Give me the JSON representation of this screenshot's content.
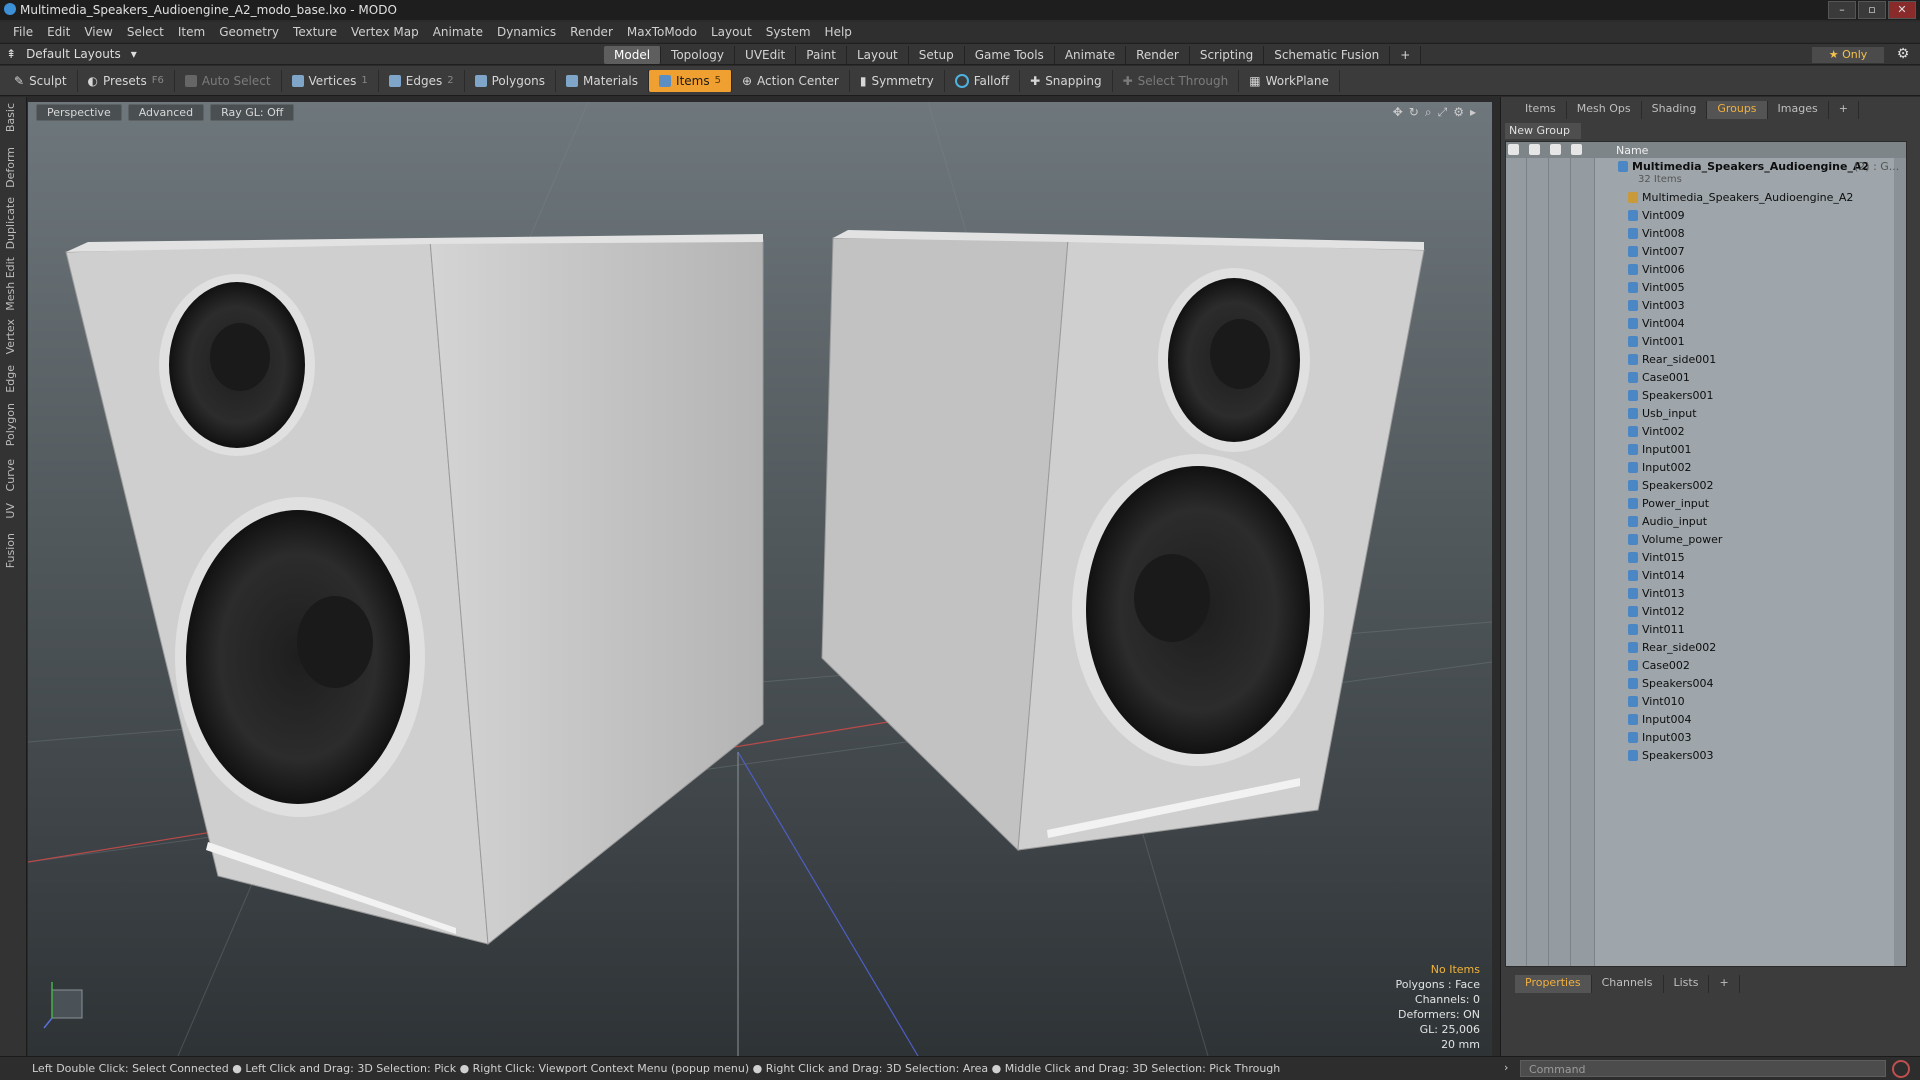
{
  "window": {
    "title": "Multimedia_Speakers_Audioengine_A2_modo_base.lxo - MODO",
    "controls": [
      "–",
      "▫",
      "✕"
    ]
  },
  "menu": [
    "File",
    "Edit",
    "View",
    "Select",
    "Item",
    "Geometry",
    "Texture",
    "Vertex Map",
    "Animate",
    "Dynamics",
    "Render",
    "MaxToModo",
    "Layout",
    "System",
    "Help"
  ],
  "layoutbar": {
    "layout": "Default Layouts",
    "tabs": [
      "Model",
      "Topology",
      "UVEdit",
      "Paint",
      "Layout",
      "Setup",
      "Game Tools",
      "Animate",
      "Render",
      "Scripting",
      "Schematic Fusion",
      "+"
    ],
    "active_tab": "Model",
    "only_label": "★ Only"
  },
  "toolbar": {
    "sculpt": "Sculpt",
    "presets": "Presets",
    "presets_key": "F6",
    "auto_select": "Auto Select",
    "vertices": "Vertices",
    "vertices_key": "1",
    "edges": "Edges",
    "edges_key": "2",
    "polygons": "Polygons",
    "materials": "Materials",
    "items": "Items",
    "items_key": "5",
    "action_center": "Action Center",
    "symmetry": "Symmetry",
    "falloff": "Falloff",
    "snapping": "Snapping",
    "select_through": "Select Through",
    "workplane": "WorkPlane"
  },
  "left_tabs": [
    "Basic",
    "Deform",
    "Duplicate",
    "Mesh Edit",
    "Vertex",
    "Edge",
    "Polygon",
    "Curve",
    "UV",
    "Fusion"
  ],
  "viewport": {
    "perspective": "Perspective",
    "advanced": "Advanced",
    "raygl": "Ray GL: Off",
    "hud": {
      "selection": "No Items",
      "polygons": "Polygons : Face",
      "channels": "Channels: 0",
      "deformers": "Deformers: ON",
      "gl": "GL: 25,006",
      "scale": "20 mm"
    }
  },
  "panel": {
    "tabs": [
      "Items",
      "Mesh Ops",
      "Shading",
      "Groups",
      "Images",
      "+"
    ],
    "active_tab": "Groups",
    "new_group": "New Group",
    "name_header": "Name",
    "root_name": "Multimedia_Speakers_Audioengine_A2",
    "root_suffix": "(2) : G...",
    "root_count": "32 Items",
    "items": [
      "Multimedia_Speakers_Audioengine_A2",
      "Vint009",
      "Vint008",
      "Vint007",
      "Vint006",
      "Vint005",
      "Vint003",
      "Vint004",
      "Vint001",
      "Rear_side001",
      "Case001",
      "Speakers001",
      "Usb_input",
      "Vint002",
      "Input001",
      "Input002",
      "Speakers002",
      "Power_input",
      "Audio_input",
      "Volume_power",
      "Vint015",
      "Vint014",
      "Vint013",
      "Vint012",
      "Vint011",
      "Rear_side002",
      "Case002",
      "Speakers004",
      "Vint010",
      "Input004",
      "Input003",
      "Speakers003"
    ],
    "bottom_tabs": [
      "Properties",
      "Channels",
      "Lists",
      "+"
    ],
    "bottom_active": "Properties"
  },
  "status": {
    "hint": "Left Double Click: Select Connected ● Left Click and Drag: 3D Selection: Pick ● Right Click: Viewport Context Menu (popup menu) ● Right Click and Drag: 3D Selection: Area ● Middle Click and Drag: 3D Selection: Pick Through",
    "command_placeholder": "Command"
  },
  "colors": {
    "accent": "#f0a030",
    "viewport_top": "#6e777c",
    "viewport_bottom": "#2e3336"
  }
}
